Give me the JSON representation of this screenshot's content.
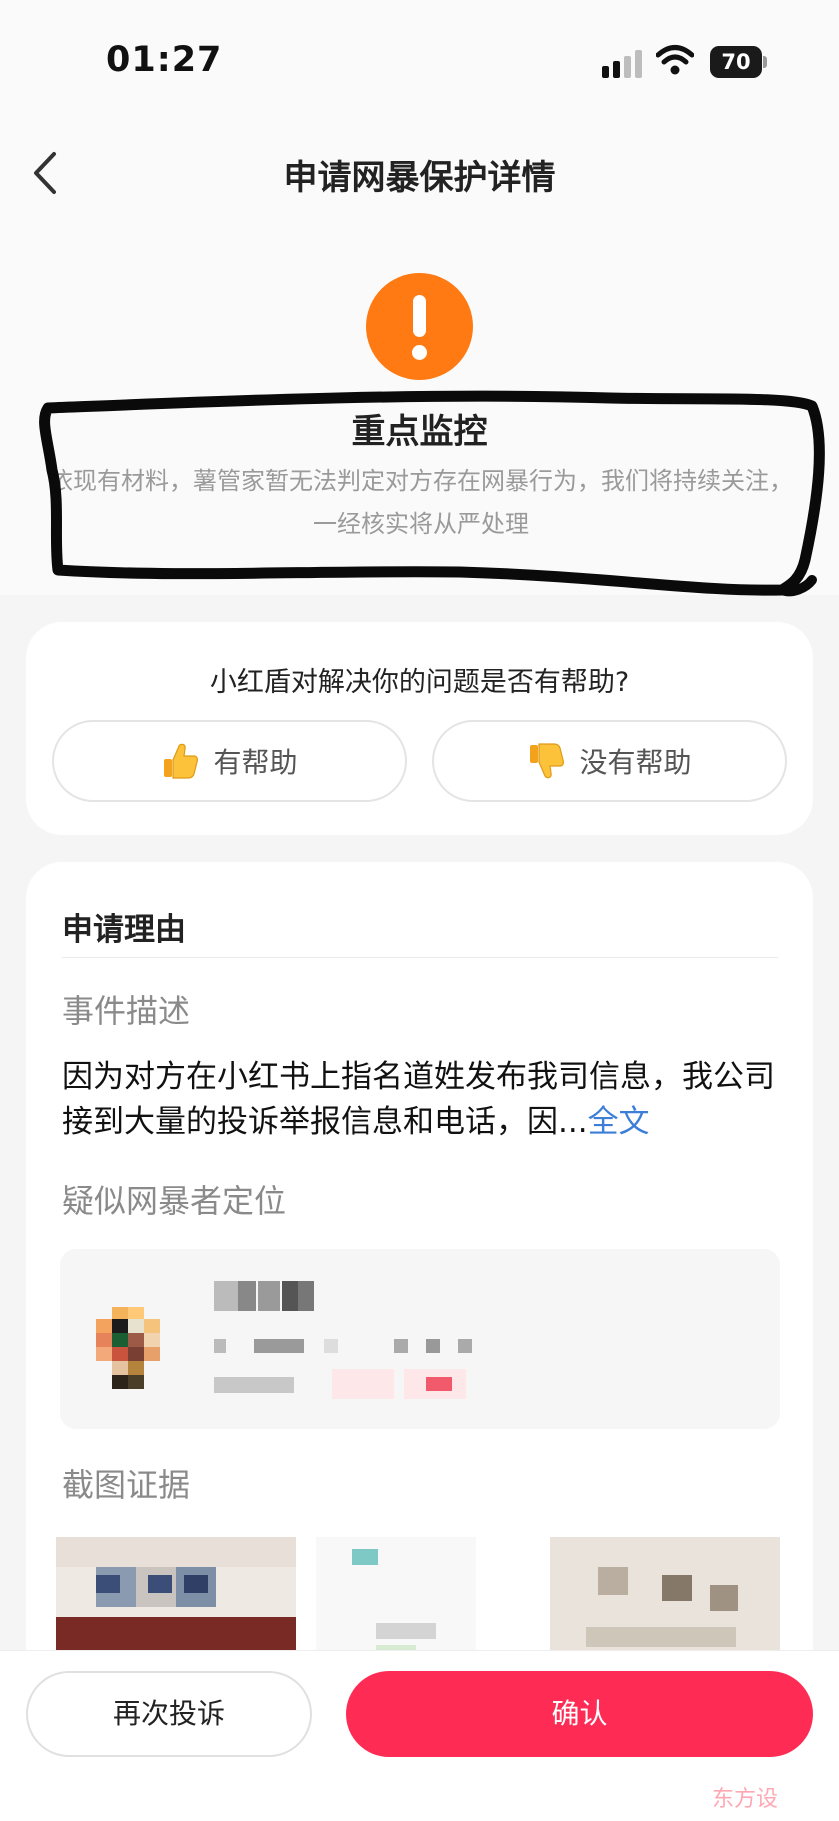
{
  "status_bar": {
    "time": "01:27",
    "battery": "70"
  },
  "nav": {
    "title": "申请网暴保护详情",
    "back_icon": "chevron-left-icon"
  },
  "status": {
    "icon": "exclamation-icon",
    "icon_color": "#ff7a13",
    "title": "重点监控",
    "description": "依现有材料，薯管家暂无法判定对方存在网暴行为，我们将持续关注，一经核实将从严处理"
  },
  "feedback": {
    "question": "小红盾对解决你的问题是否有帮助?",
    "helpful_label": "有帮助",
    "helpful_icon": "thumbs-up-icon",
    "not_helpful_label": "没有帮助",
    "not_helpful_icon": "thumbs-down-icon"
  },
  "reason": {
    "title": "申请理由",
    "event_label": "事件描述",
    "event_text": "因为对方在小红书上指名道姓发布我司信息，我公司接到大量的投诉举报信息和电话，因...",
    "full_text_link": "全文",
    "suspect_label": "疑似网暴者定位",
    "evidence_label": "截图证据"
  },
  "actions": {
    "complain_again": "再次投诉",
    "confirm": "确认",
    "confirm_color": "#fe2c55"
  },
  "watermark": "东方设"
}
